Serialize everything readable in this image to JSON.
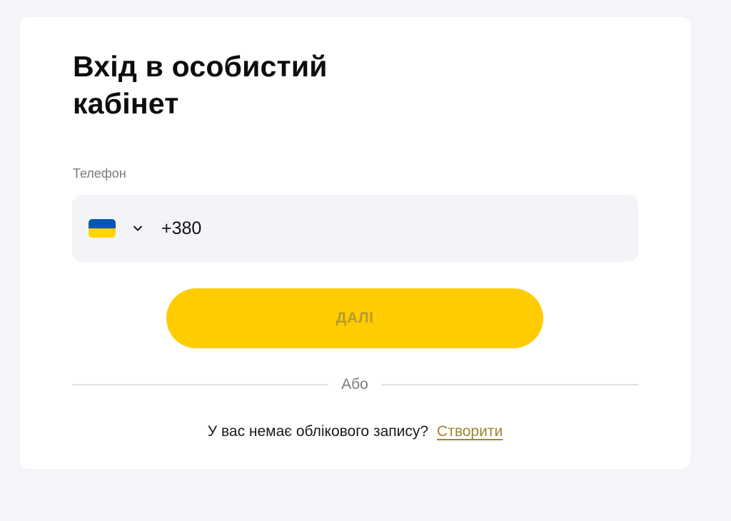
{
  "login": {
    "title_line1": "Вхід в особистий",
    "title_line2": "кабінет",
    "phone_label": "Телефон",
    "country_icon": "ukraine-flag-icon",
    "phone_value": "+380",
    "next_button_label": "ДАЛІ",
    "divider_text": "Або",
    "signup_prompt": "У вас немає облікового запису?",
    "signup_link": "Створити"
  },
  "colors": {
    "page_background": "#f4f5f9",
    "card_background": "#ffffff",
    "field_background": "#f3f4f8",
    "button_background": "#ffcc00",
    "button_text": "#b89a2c",
    "link": "#9b8531",
    "flag_blue": "#0057b8",
    "flag_yellow": "#ffd500"
  }
}
